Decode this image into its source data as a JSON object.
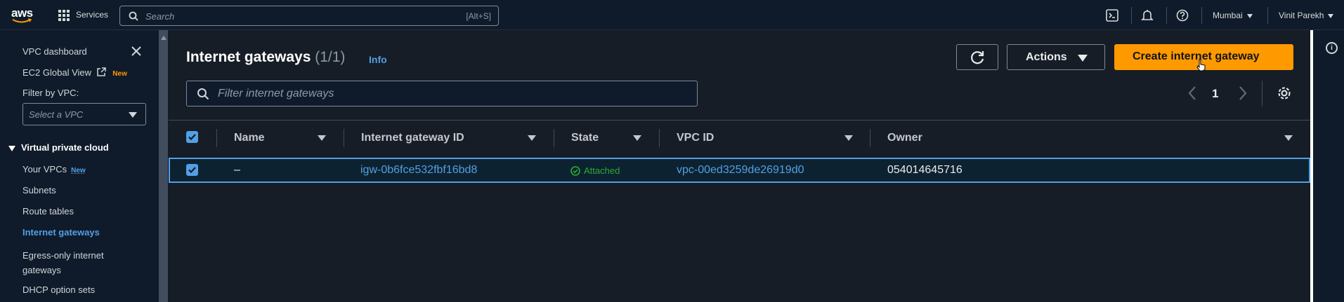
{
  "topnav": {
    "logo_text": "aws",
    "services_label": "Services",
    "search_placeholder": "Search",
    "search_shortcut": "[Alt+S]",
    "region": "Mumbai",
    "user": "Vinit Parekh",
    "icons": [
      "grid-icon",
      "search-icon",
      "cloudshell-icon",
      "bell-icon",
      "help-icon"
    ]
  },
  "sidebar": {
    "vpc_dashboard": "VPC dashboard",
    "ec2_global_view": "EC2 Global View",
    "ec2_new_badge": "New",
    "filter_label": "Filter by VPC:",
    "vpc_select_placeholder": "Select a VPC",
    "section_title": "Virtual private cloud",
    "items": [
      {
        "label": "Your VPCs",
        "badge": "New"
      },
      {
        "label": "Subnets"
      },
      {
        "label": "Route tables"
      },
      {
        "label": "Internet gateways",
        "active": true
      },
      {
        "label": "Egress-only internet gateways"
      },
      {
        "label": "DHCP option sets"
      }
    ]
  },
  "main": {
    "title": "Internet gateways",
    "count": "(1/1)",
    "info_link": "Info",
    "actions_label": "Actions",
    "create_label": "Create internet gateway",
    "filter_placeholder": "Filter internet gateways",
    "current_page": "1",
    "columns": [
      "Name",
      "Internet gateway ID",
      "State",
      "VPC ID",
      "Owner"
    ],
    "rows": [
      {
        "name": "–",
        "gateway_id": "igw-0b6fce532fbf16bd8",
        "state": "Attached",
        "vpc_id": "vpc-00ed3259de26919d0",
        "owner": "054014645716",
        "selected": true
      }
    ]
  },
  "colors": {
    "accent_orange": "#ff9900",
    "link_blue": "#539fe5",
    "success_green": "#29ad32",
    "background": "#161d26"
  }
}
